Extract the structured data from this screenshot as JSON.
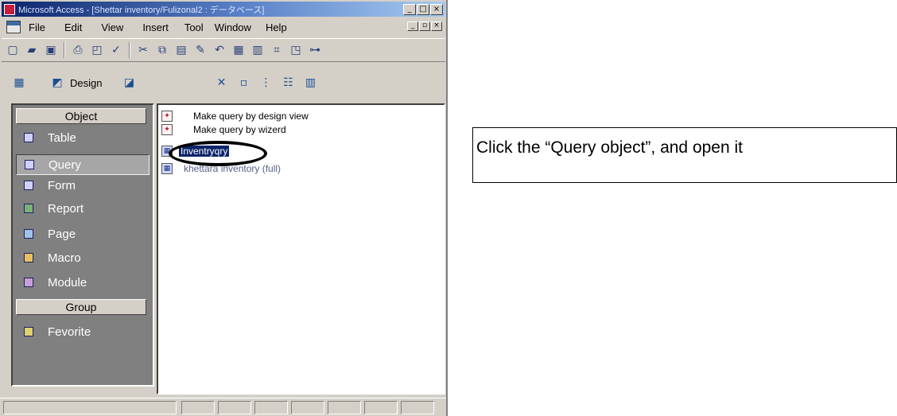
{
  "window": {
    "title": "Microsoft Access - [Shettar inventory/Fulizonal2 : データベース]",
    "controls": {
      "minimize": "_",
      "maximize": "□",
      "close": "×"
    }
  },
  "menubar": {
    "items": [
      "File",
      "Edit",
      "View",
      "Insert",
      "Tool",
      "Window",
      "Help"
    ],
    "controls": {
      "minimize": "_",
      "restore": "▫",
      "close": "×"
    }
  },
  "toolbar": {
    "icons": [
      "new-icon",
      "open-icon",
      "save-icon",
      "print-icon",
      "preview-icon",
      "spell-icon",
      "cut-icon",
      "copy-icon",
      "paste-icon",
      "format-painter-icon",
      "undo-icon",
      "office-links-icon",
      "analyze-icon",
      "code-icon",
      "properties-icon",
      "relationships-icon"
    ]
  },
  "db_toolbar": {
    "design_label": "Design"
  },
  "sidebar": {
    "objects_header": "Object",
    "items": [
      "Table",
      "Query",
      "Form",
      "Report",
      "Page",
      "Macro",
      "Module"
    ],
    "selected": "Query",
    "groups_header": "Group",
    "group_items": [
      "Fevorite"
    ]
  },
  "list": {
    "items": [
      {
        "label": "Make query by design view",
        "icon": "wand-icon"
      },
      {
        "label": "Make query by wizerd",
        "icon": "wand-icon"
      },
      {
        "label": "Inventryqry",
        "icon": "query-icon",
        "selected": true
      },
      {
        "label": "khettara inventory (full)",
        "icon": "query-icon"
      }
    ]
  },
  "instruction": {
    "text": "Click the “Query object”, and open it"
  }
}
